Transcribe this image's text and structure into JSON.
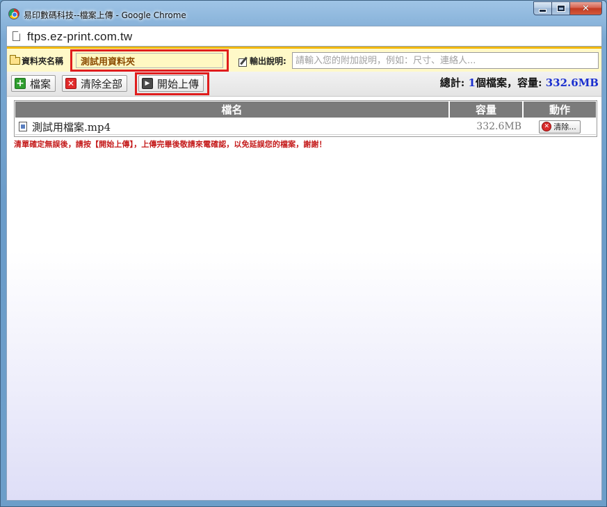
{
  "window": {
    "title": "易印數碼科技--檔案上傳 - Google Chrome",
    "buttons": {
      "minimize": "minimize",
      "maximize": "maximize",
      "close": "✕"
    }
  },
  "address": {
    "url": "ftps.ez-print.com.tw"
  },
  "folder": {
    "label": "資料夾名稱",
    "value": "測試用資料夾"
  },
  "note": {
    "label": "輸出說明:",
    "placeholder": "請輸入您的附加說明，例如：尺寸、連絡人..."
  },
  "toolbar": {
    "add_label": "檔案",
    "clear_all_label": "清除全部",
    "start_label": "開始上傳"
  },
  "summary": {
    "prefix": "總計: ",
    "count": "1",
    "mid": "個檔案，容量: ",
    "size": "332.6MB"
  },
  "table": {
    "headers": {
      "name": "檔名",
      "size": "容量",
      "action": "動作"
    },
    "rows": [
      {
        "name": "測試用檔案.mp4",
        "size": "332.6MB",
        "action": "清除..."
      }
    ]
  },
  "notice": "清單確定無誤後，請按【開始上傳】，上傳完畢後敬請來電確認，以免延誤您的檔案，謝謝！",
  "colors": {
    "accent_red": "#e01d1d",
    "summary_blue": "#1a2fcf",
    "notice_red": "#c41a1a",
    "folder_bar_bg": "#fff9c8"
  }
}
